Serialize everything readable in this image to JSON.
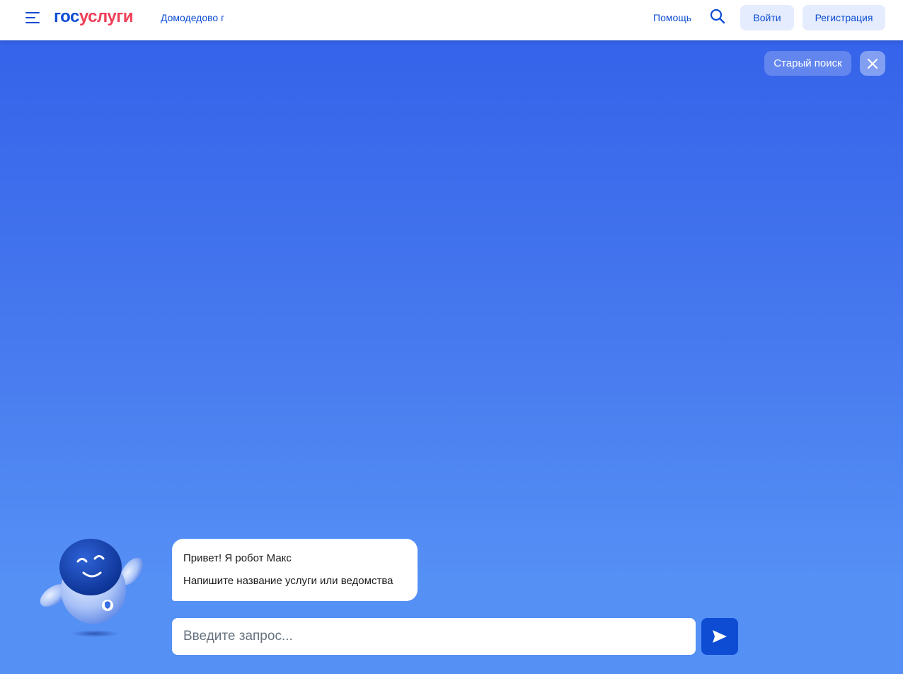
{
  "header": {
    "logo_part1": "гос",
    "logo_part2": "услуги",
    "city": "Домодедово г",
    "help": "Помощь",
    "login": "Войти",
    "register": "Регистрация"
  },
  "main": {
    "old_search": "Старый поиск",
    "chat": {
      "greeting": "Привет! Я робот Макс",
      "prompt": "Напишите название услуги или ведомства"
    },
    "input": {
      "placeholder": "Введите запрос...",
      "value": ""
    }
  },
  "icons": {
    "menu": "menu-icon",
    "search": "search-icon",
    "close": "close-icon",
    "send": "send-icon",
    "mascot": "robot-mascot"
  },
  "colors": {
    "brand_blue": "#0d4cd3",
    "brand_red": "#ee3f58",
    "button_light": "#e4ecfd",
    "gradient_top": "#3563ea",
    "gradient_bottom": "#5590f5"
  }
}
